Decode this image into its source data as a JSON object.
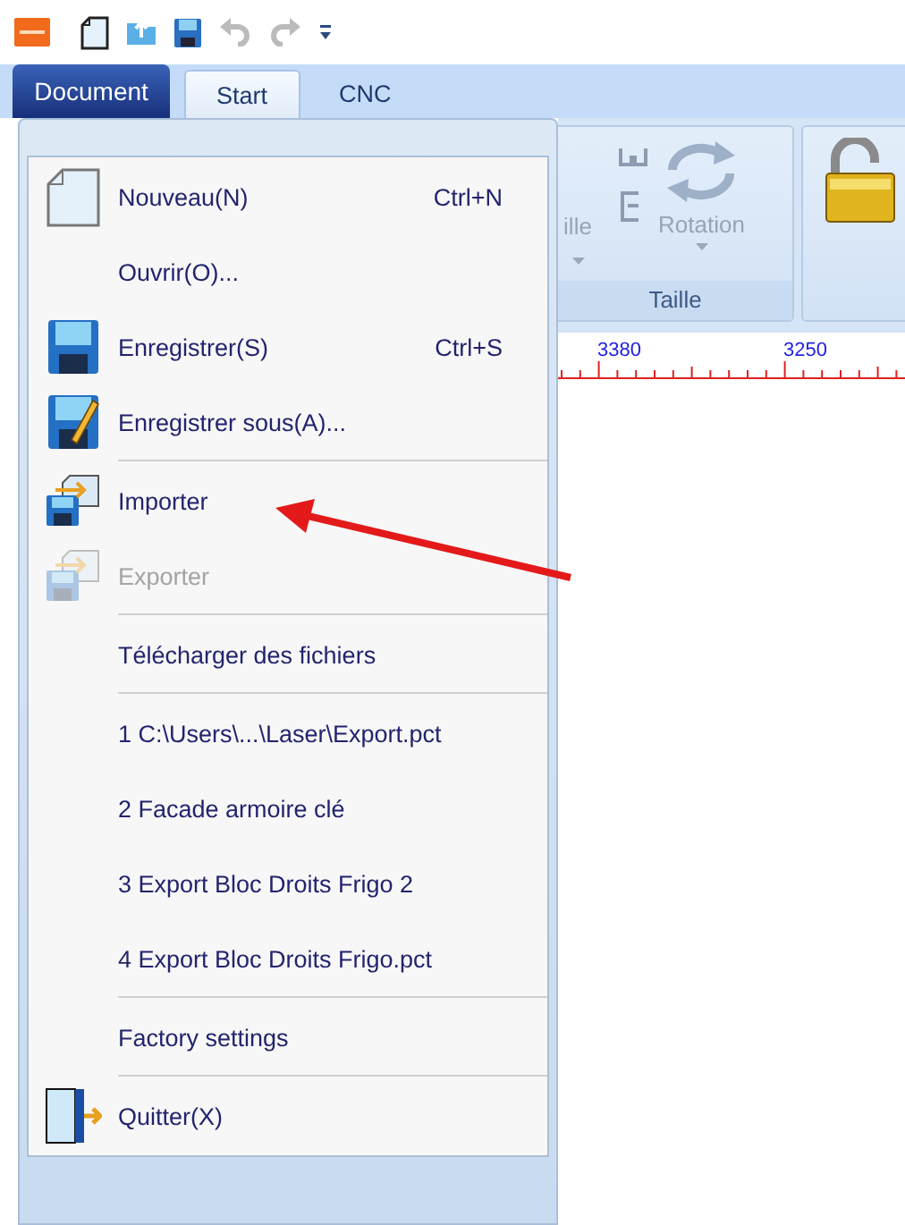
{
  "quick_access": [
    {
      "kind": "logo",
      "disabled": false
    },
    {
      "kind": "new",
      "disabled": false
    },
    {
      "kind": "open",
      "disabled": false
    },
    {
      "kind": "save",
      "disabled": false
    },
    {
      "kind": "undo",
      "disabled": true
    },
    {
      "kind": "redo",
      "disabled": true
    },
    {
      "kind": "customize",
      "disabled": false
    }
  ],
  "app_button": {
    "label": "Document",
    "expanded": true
  },
  "tabs": [
    {
      "label": "Start",
      "selected": true
    },
    {
      "label": "CNC",
      "selected": false
    }
  ],
  "menu": [
    {
      "kind": "new",
      "label": "Nouveau(N)",
      "shortcut": "Ctrl+N",
      "disabled": false
    },
    {
      "kind": "plain",
      "label": "Ouvrir(O)...",
      "disabled": false
    },
    {
      "kind": "save",
      "label": "Enregistrer(S)",
      "shortcut": "Ctrl+S",
      "disabled": false
    },
    {
      "kind": "save-as",
      "label": "Enregistrer sous(A)...",
      "disabled": false
    },
    {
      "kind": "separator"
    },
    {
      "kind": "import",
      "label": "Importer",
      "disabled": false
    },
    {
      "kind": "export",
      "label": "Exporter",
      "disabled": true
    },
    {
      "kind": "separator"
    },
    {
      "kind": "plain",
      "label": "Télécharger des fichiers",
      "disabled": false
    },
    {
      "kind": "separator"
    },
    {
      "kind": "plain",
      "label": "1 C:\\Users\\...\\Laser\\Export.pct",
      "disabled": false
    },
    {
      "kind": "plain",
      "label": "2 Facade armoire clé",
      "disabled": false
    },
    {
      "kind": "plain",
      "label": "3 Export Bloc Droits Frigo 2",
      "disabled": false
    },
    {
      "kind": "plain",
      "label": "4 Export Bloc Droits Frigo.pct",
      "disabled": false
    },
    {
      "kind": "separator"
    },
    {
      "kind": "plain",
      "label": "Factory settings",
      "disabled": false
    },
    {
      "kind": "separator"
    },
    {
      "kind": "exit",
      "label": "Quitter(X)",
      "disabled": false
    }
  ],
  "ribbon": {
    "size_button": "ille",
    "rotate_button": "Rotation",
    "group_label": "Taille"
  },
  "ruler": {
    "labels": [
      "3380",
      "3250"
    ]
  }
}
